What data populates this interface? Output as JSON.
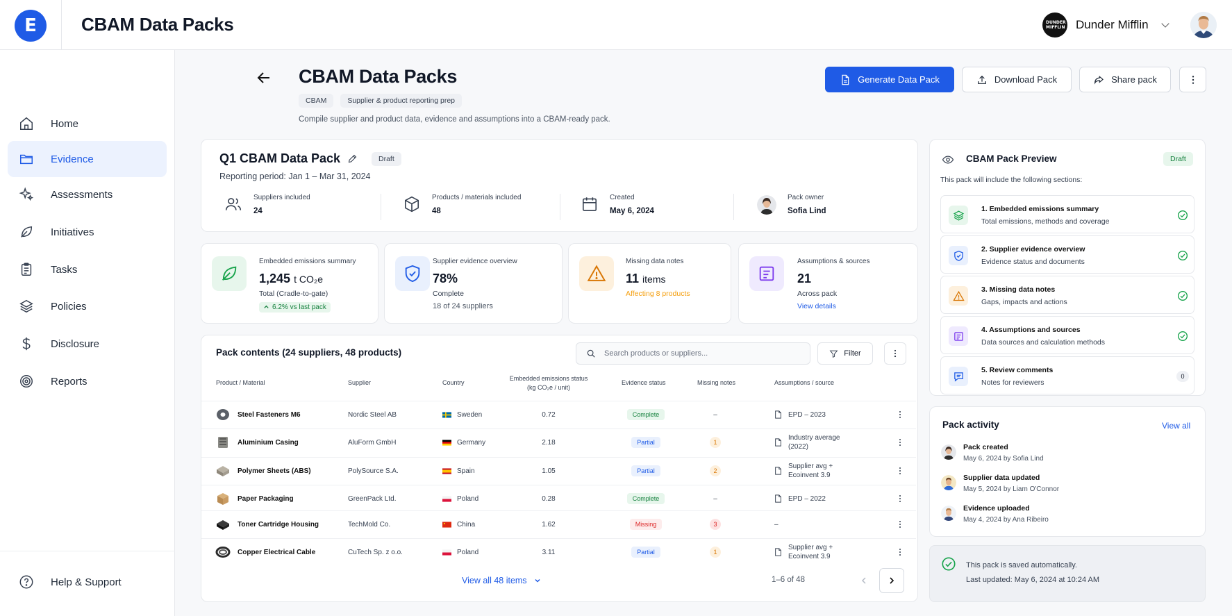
{
  "app": {
    "logo_letter": "E",
    "title": "CBAM Data Packs"
  },
  "company": {
    "logo_text": "DUNDER MIFFLIN",
    "name": "Dunder Mifflin"
  },
  "sidebar": {
    "items": [
      {
        "label": "Home",
        "icon": "home-icon"
      },
      {
        "label": "Evidence",
        "icon": "folder-icon",
        "active": true
      },
      {
        "label": "Assessments",
        "icon": "sparkle-icon"
      },
      {
        "label": "Initiatives",
        "icon": "leaf-icon"
      },
      {
        "label": "Tasks",
        "icon": "clipboard-icon"
      },
      {
        "label": "Policies",
        "icon": "layers-icon"
      },
      {
        "label": "Disclosure",
        "icon": "dollar-icon"
      },
      {
        "label": "Reports",
        "icon": "target-icon"
      }
    ],
    "help": "Help & Support"
  },
  "page": {
    "title": "CBAM Data Packs",
    "tags": [
      "CBAM",
      "Supplier & product reporting prep"
    ],
    "subtitle": "Compile supplier and product data, evidence and assumptions into a CBAM-ready pack."
  },
  "actions": {
    "generate": "Generate Data Pack",
    "download": "Download Pack",
    "share": "Share pack"
  },
  "pack": {
    "title": "Q1 CBAM Data Pack",
    "status": "Draft",
    "period": "Reporting period: Jan 1 – Mar 31, 2024",
    "meta": [
      {
        "label": "Suppliers included",
        "value": "24"
      },
      {
        "label": "Products / materials included",
        "value": "48"
      },
      {
        "label": "Created",
        "value": "May 6, 2024"
      },
      {
        "label": "Pack owner",
        "value": "Sofia Lind"
      }
    ]
  },
  "stats": {
    "emissions": {
      "label": "Embedded emissions summary",
      "value": "1,245",
      "unit": "t CO₂e",
      "sub": "Total (Cradle-to-gate)",
      "delta": "6.2% vs last pack"
    },
    "evidence": {
      "label": "Supplier evidence overview",
      "value": "78%",
      "sub": "Complete",
      "sub2": "18 of 24 suppliers"
    },
    "missing": {
      "label": "Missing data notes",
      "value": "11",
      "unit": "items",
      "sub": "Affecting 8 products"
    },
    "assumptions": {
      "label": "Assumptions & sources",
      "value": "21",
      "sub": "Across pack",
      "link": "View details"
    }
  },
  "table": {
    "title": "Pack contents (24 suppliers, 48 products)",
    "search_placeholder": "Search products or suppliers...",
    "filter": "Filter",
    "headers": {
      "product": "Product / Material",
      "supplier": "Supplier",
      "country": "Country",
      "emissions1": "Embedded emissions status",
      "emissions2": "(kg CO₂e / unit)",
      "evidence": "Evidence status",
      "missing": "Missing notes",
      "assumptions": "Assumptions / source"
    },
    "rows": [
      {
        "product": "Steel Fasteners M6",
        "supplier": "Nordic Steel AB",
        "country": "Sweden",
        "emissions": "0.72",
        "status": "Complete",
        "missing": "–",
        "source1": "EPD – 2023",
        "source2": ""
      },
      {
        "product": "Aluminium Casing",
        "supplier": "AluForm GmbH",
        "country": "Germany",
        "emissions": "2.18",
        "status": "Partial",
        "missing": "1",
        "source1": "Industry average",
        "source2": "(2022)"
      },
      {
        "product": "Polymer Sheets (ABS)",
        "supplier": "PolySource S.A.",
        "country": "Spain",
        "emissions": "1.05",
        "status": "Partial",
        "missing": "2",
        "source1": "Supplier avg +",
        "source2": "Ecoinvent 3.9"
      },
      {
        "product": "Paper Packaging",
        "supplier": "GreenPack Ltd.",
        "country": "Poland",
        "emissions": "0.28",
        "status": "Complete",
        "missing": "–",
        "source1": "EPD – 2022",
        "source2": ""
      },
      {
        "product": "Toner Cartridge Housing",
        "supplier": "TechMold Co.",
        "country": "China",
        "emissions": "1.62",
        "status": "Missing",
        "missing": "3",
        "source1": "–",
        "source2": ""
      },
      {
        "product": "Copper Electrical Cable",
        "supplier": "CuTech Sp. z o.o.",
        "country": "Poland",
        "emissions": "3.11",
        "status": "Partial",
        "missing": "1",
        "source1": "Supplier avg +",
        "source2": "Ecoinvent 3.9"
      }
    ],
    "view_all": "View all 48 items",
    "pagination": "1–6 of 48"
  },
  "preview": {
    "title": "CBAM Pack Preview",
    "status": "Draft",
    "desc": "This pack will include the following sections:",
    "sections": [
      {
        "title": "1. Embedded emissions summary",
        "desc": "Total emissions, methods and coverage"
      },
      {
        "title": "2. Supplier evidence overview",
        "desc": "Evidence status and documents"
      },
      {
        "title": "3. Missing data notes",
        "desc": "Gaps, impacts and actions"
      },
      {
        "title": "4. Assumptions and sources",
        "desc": "Data sources and calculation methods"
      },
      {
        "title": "5. Review comments",
        "desc": "Notes for reviewers",
        "count": "0"
      }
    ]
  },
  "activity": {
    "title": "Pack activity",
    "view_all": "View all",
    "items": [
      {
        "title": "Pack created",
        "meta": "May 6, 2024 by Sofia Lind"
      },
      {
        "title": "Supplier data updated",
        "meta": "May 5, 2024 by Liam O'Connor"
      },
      {
        "title": "Evidence uploaded",
        "meta": "May 4, 2024 by Ana Ribeiro"
      }
    ]
  },
  "autosave": {
    "title": "This pack is saved automatically.",
    "meta": "Last updated: May 6, 2024 at 10:24 AM"
  },
  "colors": {
    "primary": "#1f5be6",
    "success": "#16a34a",
    "warning": "#f59e0b",
    "danger": "#dc2626"
  }
}
